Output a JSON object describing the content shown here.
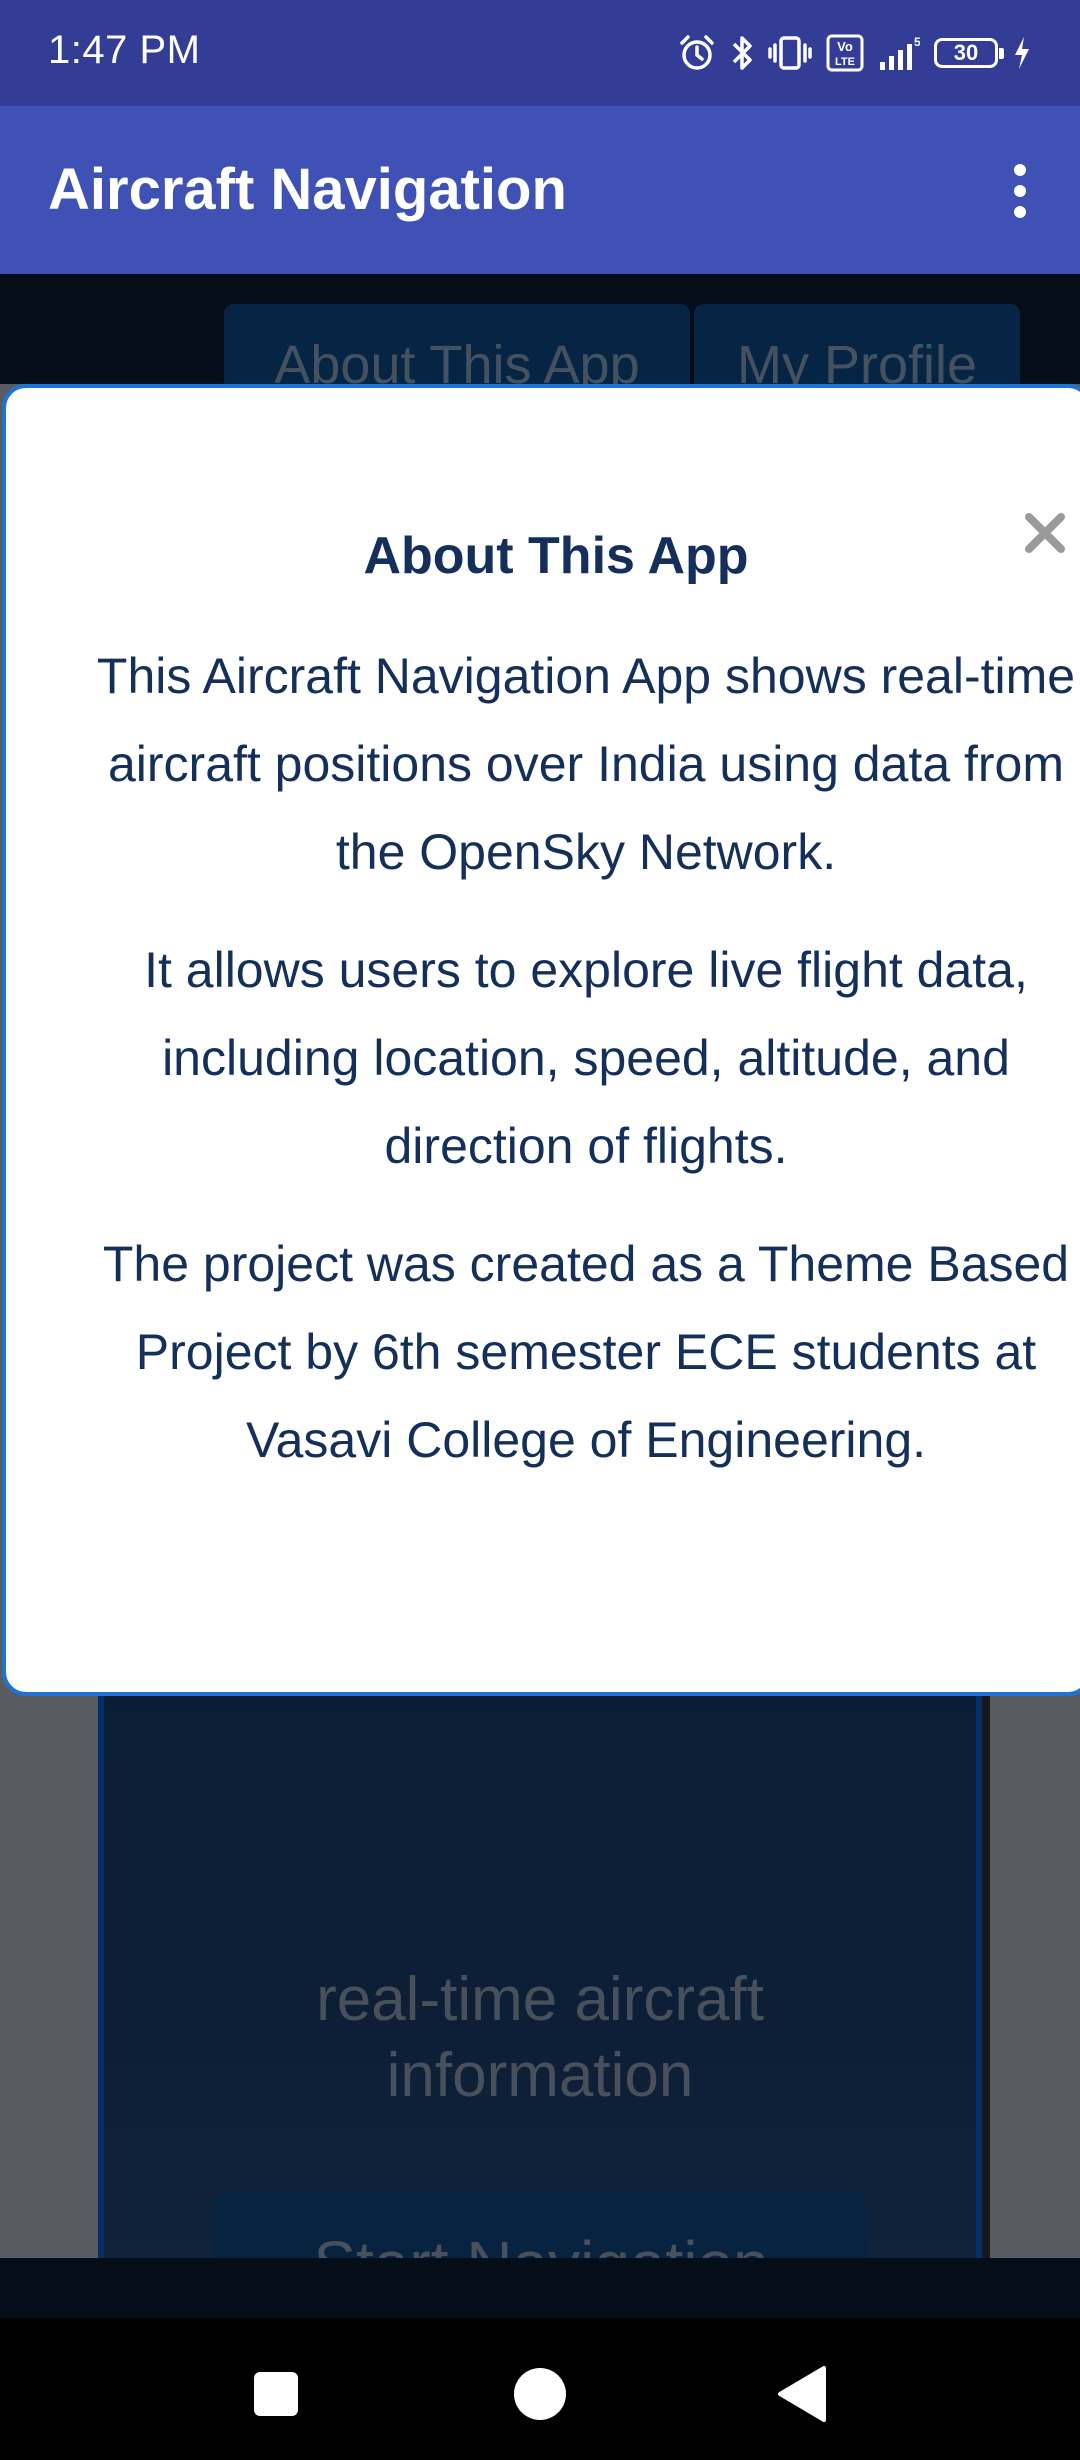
{
  "status_bar": {
    "time": "1:47 PM",
    "battery": "30",
    "icons": [
      "alarm-icon",
      "bluetooth-icon",
      "vibrate-icon",
      "volte-icon",
      "signal-icon",
      "5g-icon",
      "battery-icon",
      "charging-icon"
    ]
  },
  "app_bar": {
    "title": "Aircraft Navigation",
    "menu_icon": "overflow-menu-icon"
  },
  "web": {
    "tabs": [
      "About This App",
      "My Profile"
    ],
    "hero_text_line1": "real-time aircraft",
    "hero_text_line2": "information",
    "start_button": "Start Navigation"
  },
  "modal": {
    "title": "About This App",
    "close_symbol": "×",
    "paragraphs": [
      "This Aircraft Navigation App shows real-time aircraft positions over India using data from the OpenSky Network.",
      "It allows users to explore live flight data, including location, speed, altitude, and direction of flights.",
      "The project was created as a Theme Based Project by 6th semester ECE students at Vasavi College of Engineering."
    ]
  },
  "nav_bar": {
    "buttons": [
      "recents-icon",
      "home-icon",
      "back-icon"
    ]
  },
  "colors": {
    "status_bar": "#333d96",
    "app_bar": "#3f51b5",
    "modal_border": "#1e73d8",
    "modal_text": "#14305a"
  }
}
